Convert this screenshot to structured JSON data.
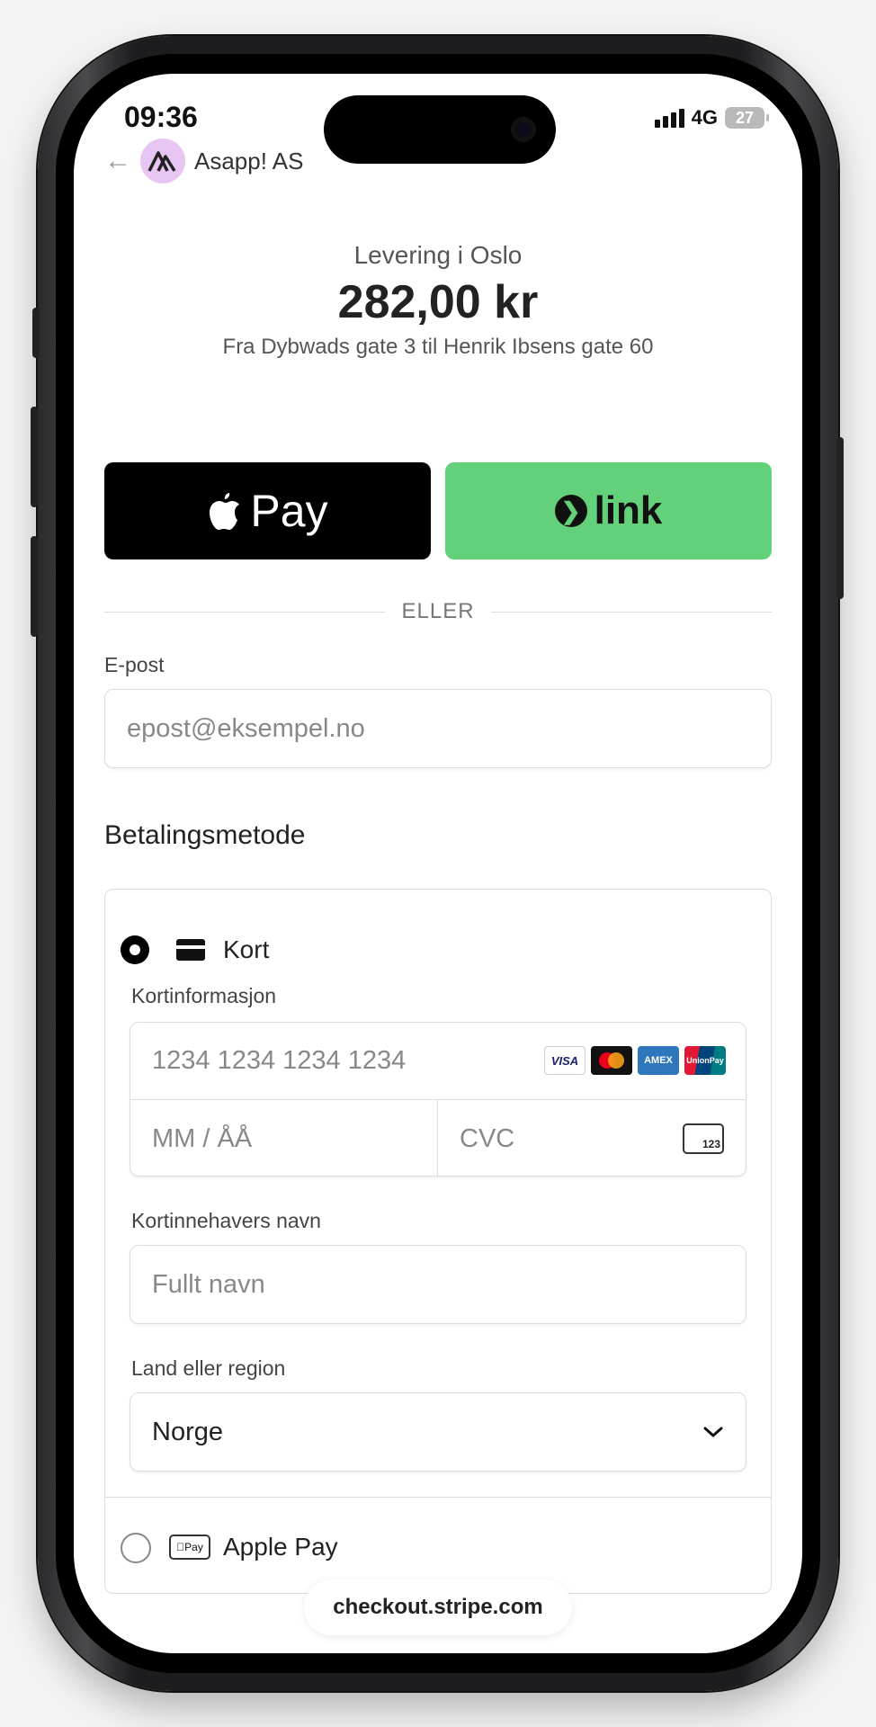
{
  "status_bar": {
    "time": "09:36",
    "network": "4G",
    "battery": "27"
  },
  "merchant": {
    "name": "Asapp! AS",
    "back_icon": "arrow-left-icon",
    "logo_color": "#e7c6f3"
  },
  "summary": {
    "product": "Levering i Oslo",
    "price": "282,00 kr",
    "route": "Fra Dybwads gate 3 til Henrik Ibsens gate 60"
  },
  "wallets": {
    "apple_pay_label": "Pay",
    "link_label": "link",
    "link_color": "#63d07a"
  },
  "divider": "ELLER",
  "email": {
    "label": "E-post",
    "placeholder": "epost@eksempel.no"
  },
  "payment_method": {
    "title": "Betalingsmetode",
    "card_option_label": "Kort",
    "card_info_label": "Kortinformasjon",
    "card_number_placeholder": "1234 1234 1234 1234",
    "expiry_placeholder": "MM / ÅÅ",
    "cvc_placeholder": "CVC",
    "cvc_icon_text": "123",
    "brands": [
      "VISA",
      "Mastercard",
      "AMEX",
      "UnionPay"
    ],
    "holder_label": "Kortinnehavers navn",
    "holder_placeholder": "Fullt navn",
    "country_label": "Land eller region",
    "country_value": "Norge",
    "apple_pay_option_label": "Apple Pay",
    "apple_pay_mini": "Pay"
  },
  "browser": {
    "url": "checkout.stripe.com"
  }
}
